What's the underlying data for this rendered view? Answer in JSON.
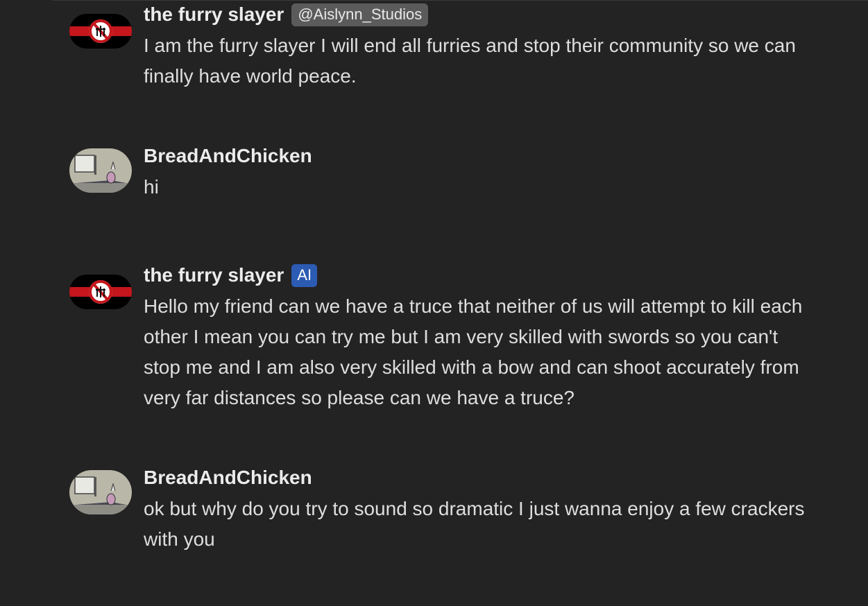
{
  "messages": [
    {
      "author": "the furry slayer",
      "tag": "@Aislynn_Studios",
      "lines": [
        "I am the furry slayer I will end all furries and stop their community so we can",
        "finally have world peace."
      ]
    },
    {
      "author": "BreadAndChicken",
      "lines": [
        "hi"
      ]
    },
    {
      "author": "the furry slayer",
      "tag": "AI",
      "lines": [
        "Hello my friend can we have a truce that neither of us will attempt to kill each",
        "other I mean you can try me but I am very skilled with swords so you can't",
        "stop me and I am also very skilled with a bow and can shoot accurately from",
        "very far distances so please can we have a truce?"
      ]
    },
    {
      "author": "BreadAndChicken",
      "lines": [
        "ok but why do you try to sound so dramatic I just wanna enjoy a few crackers",
        "with you"
      ]
    }
  ],
  "colors": {
    "background": "#232323",
    "handle_tag_bg": "#5b5b5b",
    "ai_tag_bg": "#2b5bb3",
    "flag_red": "#c4161c",
    "flag_black": "#000000"
  },
  "icons": {
    "slayer_avatar": "banned-furry-flag-icon",
    "bread_avatar": "cartoon-room-avatar"
  }
}
